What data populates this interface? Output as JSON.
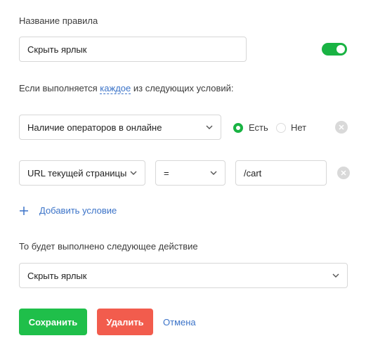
{
  "rule": {
    "name_label": "Название правила",
    "name_value": "Скрыть ярлык",
    "enabled": true
  },
  "condition_intro": {
    "prefix": "Если выполняется",
    "mode": "каждое",
    "suffix": "из следующих условий:"
  },
  "conditions": [
    {
      "field": "Наличие операторов в онлайне",
      "options": [
        "Есть",
        "Нет"
      ],
      "selected": "Есть"
    },
    {
      "field": "URL текущей страницы",
      "operator": "=",
      "value": "/cart"
    }
  ],
  "add_condition_label": "Добавить условие",
  "action": {
    "label": "То будет выполнено следующее действие",
    "selected": "Скрыть ярлык"
  },
  "buttons": {
    "save": "Сохранить",
    "delete": "Удалить",
    "cancel": "Отмена"
  },
  "colors": {
    "accent_green": "#1fbf4a",
    "danger_red": "#f25c4d",
    "link_blue": "#3b73c8"
  },
  "icons": {
    "chevron": "chevron-down-icon",
    "remove": "close-icon",
    "add": "plus-icon"
  }
}
